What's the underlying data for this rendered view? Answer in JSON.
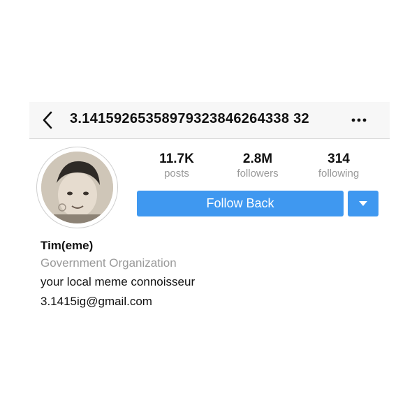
{
  "header": {
    "username": "3.14159265358979323846264338 32",
    "back_icon": "chevron-left-icon",
    "more_icon": "more-horizontal-icon"
  },
  "profile": {
    "avatar_description": "profile photo of a child",
    "stats": [
      {
        "value": "11.7K",
        "label": "posts"
      },
      {
        "value": "2.8M",
        "label": "followers"
      },
      {
        "value": "314",
        "label": "following"
      }
    ],
    "follow_button_label": "Follow Back",
    "dropdown_icon": "caret-down-icon",
    "display_name": "Tim(eme)",
    "category": "Government Organization",
    "bio": "your local meme connoisseur",
    "email": "3.1415ig@gmail.com"
  },
  "colors": {
    "accent": "#3f98f0",
    "muted_text": "#9a9a9a",
    "header_bg": "#f7f7f7"
  }
}
